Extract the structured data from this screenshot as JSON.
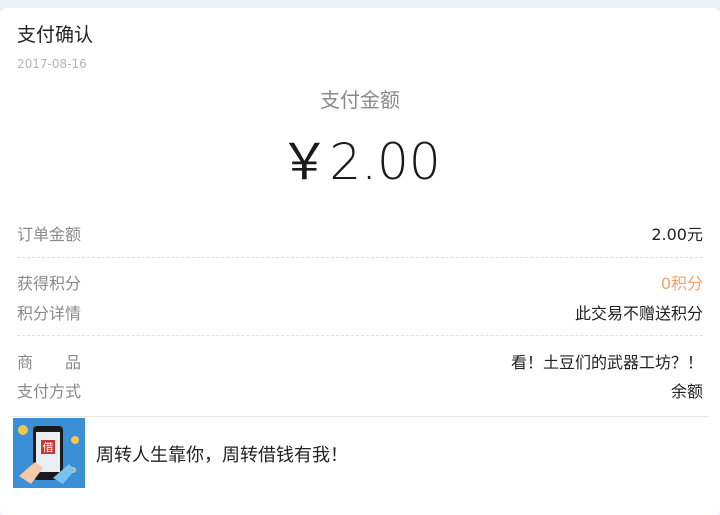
{
  "header": {
    "title": "支付确认",
    "date": "2017-08-16"
  },
  "payment": {
    "amount_label": "支付金额",
    "amount": "￥2.00"
  },
  "details": {
    "order_amount": {
      "label": "订单金额",
      "value": "2.00元"
    },
    "points_earned": {
      "label": "获得积分",
      "value": "0积分"
    },
    "points_detail": {
      "label": "积分详情",
      "value": "此交易不赠送积分"
    },
    "product": {
      "label": "商　　品",
      "value": "看！土豆们的武器工坊？！"
    },
    "pay_method": {
      "label": "支付方式",
      "value": "余额"
    }
  },
  "promo": {
    "icon_glyph": "借",
    "icon": "phone-loan-icon",
    "text": "周转人生靠你，周转借钱有我！"
  },
  "colors": {
    "accent_orange": "#f5a06a",
    "promo_blue": "#3a8fd6"
  }
}
